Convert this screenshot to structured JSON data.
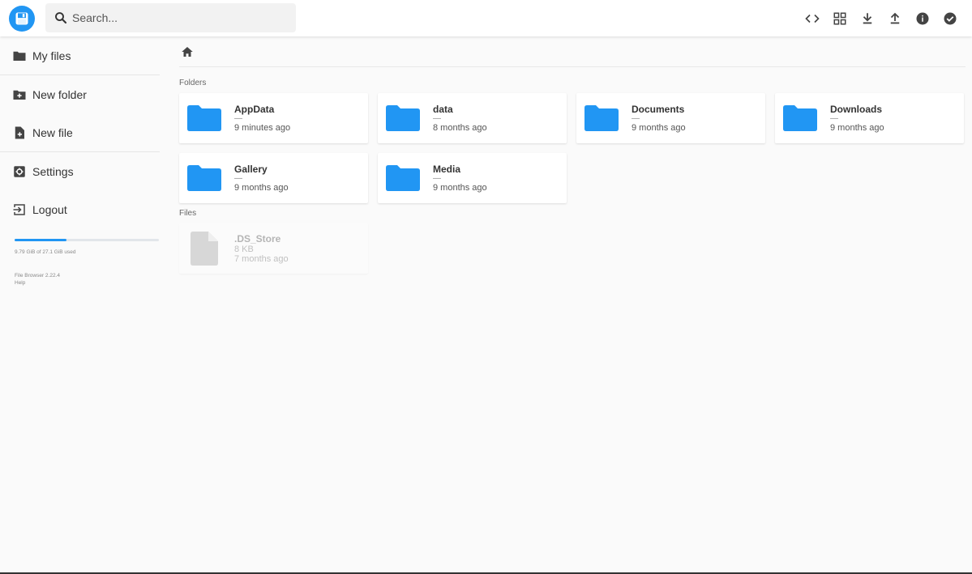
{
  "header": {
    "search_placeholder": "Search...",
    "toolbar": [
      "code-icon",
      "grid-view-icon",
      "download-icon",
      "upload-icon",
      "info-icon",
      "check-circle-icon"
    ]
  },
  "sidebar": {
    "items": [
      {
        "label": "My files",
        "icon": "folder-icon"
      },
      {
        "label": "New folder",
        "icon": "create-folder-icon"
      },
      {
        "label": "New file",
        "icon": "note-add-icon"
      },
      {
        "label": "Settings",
        "icon": "settings-icon"
      },
      {
        "label": "Logout",
        "icon": "logout-icon"
      }
    ],
    "quota_text": "9.79 GiB of 27.1 GiB used",
    "quota_fraction": 0.361,
    "version": "File Browser 2.22.4",
    "help": "Help"
  },
  "main": {
    "folders_title": "Folders",
    "files_title": "Files",
    "folders": [
      {
        "name": "AppData",
        "size": "—",
        "modified": "9 minutes ago"
      },
      {
        "name": "data",
        "size": "—",
        "modified": "8 months ago"
      },
      {
        "name": "Documents",
        "size": "—",
        "modified": "9 months ago"
      },
      {
        "name": "Downloads",
        "size": "—",
        "modified": "9 months ago"
      },
      {
        "name": "Gallery",
        "size": "—",
        "modified": "9 months ago"
      },
      {
        "name": "Media",
        "size": "—",
        "modified": "9 months ago"
      }
    ],
    "files": [
      {
        "name": ".DS_Store",
        "size": "8 KB",
        "modified": "7 months ago"
      }
    ]
  },
  "colors": {
    "accent": "#2196f3",
    "folder": "#2196f3"
  }
}
